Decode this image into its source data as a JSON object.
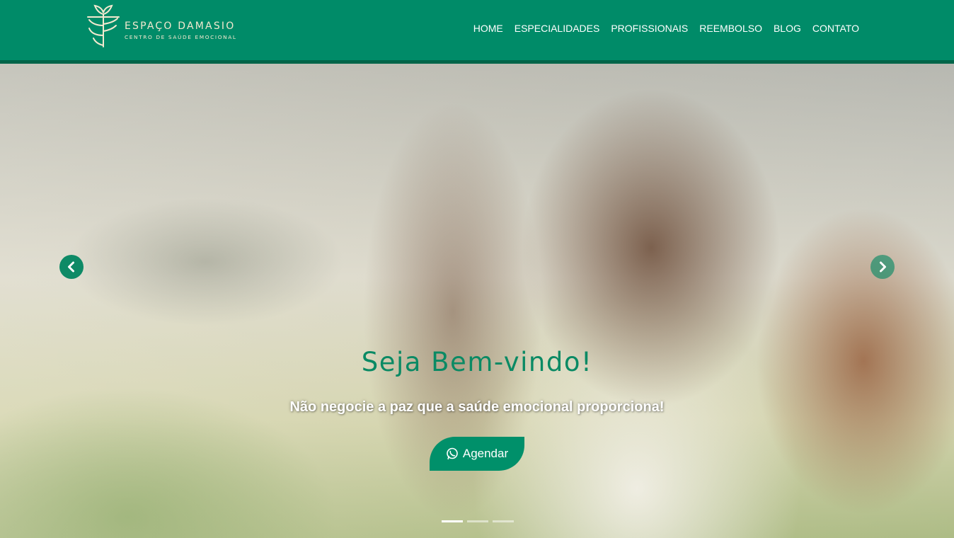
{
  "brand": {
    "name": "ESPAÇO DAMASIO",
    "tagline": "CENTRO DE SAÚDE EMOCIONAL"
  },
  "nav": {
    "items": [
      {
        "label": "HOME"
      },
      {
        "label": "ESPECIALIDADES"
      },
      {
        "label": "PROFISSIONAIS"
      },
      {
        "label": "REEMBOLSO"
      },
      {
        "label": "BLOG"
      },
      {
        "label": "CONTATO"
      }
    ]
  },
  "hero": {
    "title": "Seja Bem-vindo!",
    "subtitle": "Não negocie a paz que a saúde emocional proporciona!",
    "cta_label": "Agendar",
    "cta_icon": "whatsapp-icon",
    "prev_icon": "chevron-left-icon",
    "next_icon": "chevron-right-icon",
    "slides_total": 3,
    "active_slide": 1
  },
  "colors": {
    "primary": "#008b68",
    "header_border": "#016549",
    "logo_text": "#f3e9cf",
    "title": "#0a8a64"
  }
}
